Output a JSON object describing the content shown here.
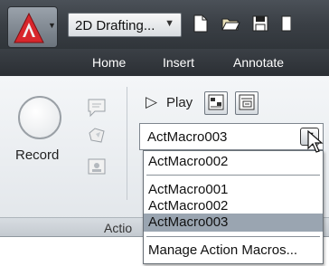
{
  "title_bar": {
    "workspace_selector": "2D Drafting...",
    "workspace_caret_icon": "chevron-down-icon",
    "quick_access_icons": [
      "new-file-icon",
      "open-folder-icon",
      "save-icon"
    ]
  },
  "ribbon_tabs": [
    {
      "label": "Home"
    },
    {
      "label": "Insert"
    },
    {
      "label": "Annotate"
    }
  ],
  "panel": {
    "record_label": "Record",
    "play_label": "Play",
    "footer_title": "Actio",
    "macro_combo_value": "ActMacro003"
  },
  "dropdown": {
    "recent": "ActMacro002",
    "items": [
      "ActMacro001",
      "ActMacro002",
      "ActMacro003"
    ],
    "selected_index": 2,
    "manage_label": "Manage Action Macros..."
  },
  "colors": {
    "title_bar": "#3a3f45",
    "ribbon_panel": "#eef1f4",
    "selection": "#9aa5b1",
    "logo_red": "#d8262c"
  }
}
